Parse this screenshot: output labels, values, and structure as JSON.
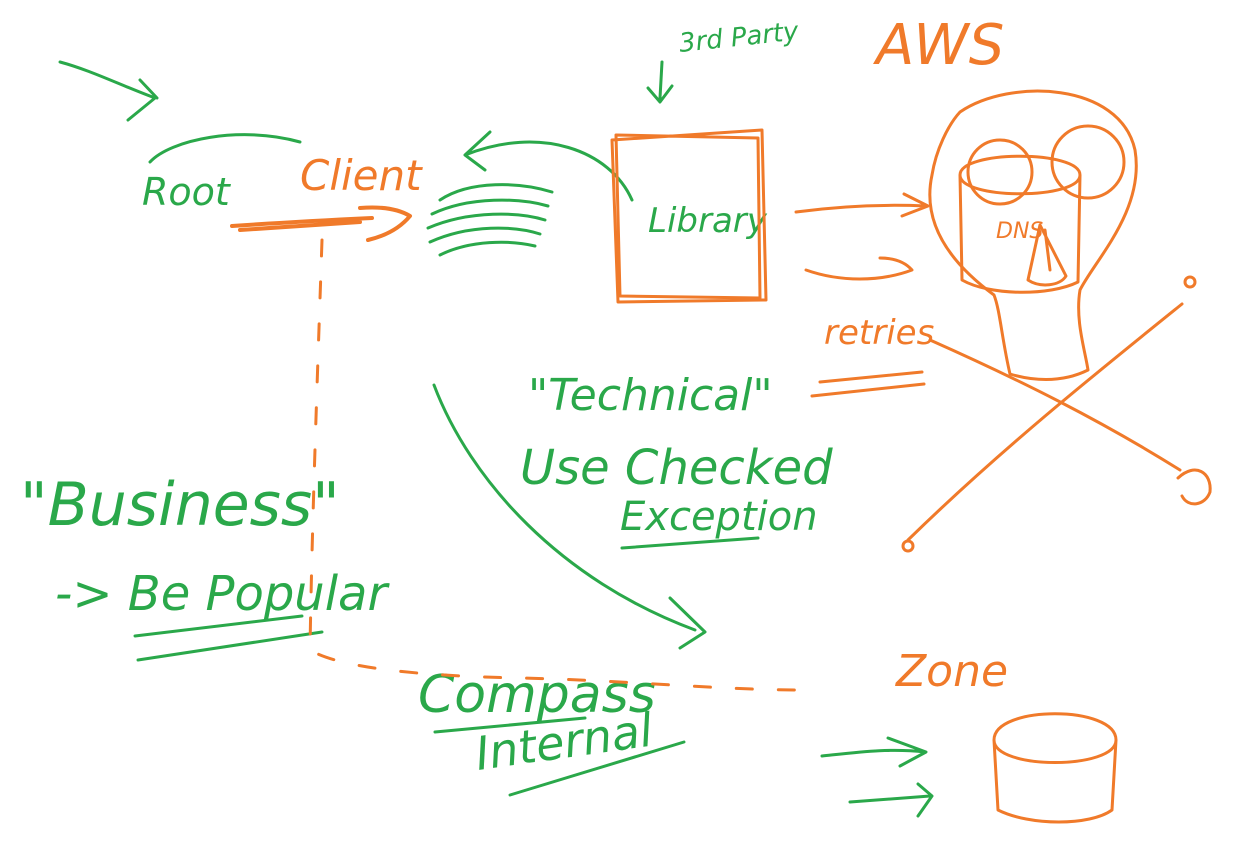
{
  "colors": {
    "green": "#2aa84a",
    "orange": "#f07a2a",
    "background": "#ffffff"
  },
  "labels": {
    "third_party": "3rd Party",
    "aws": "AWS",
    "client": "Client",
    "root": "Root",
    "library": "Library",
    "retries": "retries",
    "technical": "\"Technical\"",
    "use_checked": "Use Checked",
    "exception": "Exception",
    "business": "\"Business\"",
    "be_popular": "-> Be Popular",
    "compass": "Compass",
    "internal": "Internal",
    "zone": "Zone"
  }
}
